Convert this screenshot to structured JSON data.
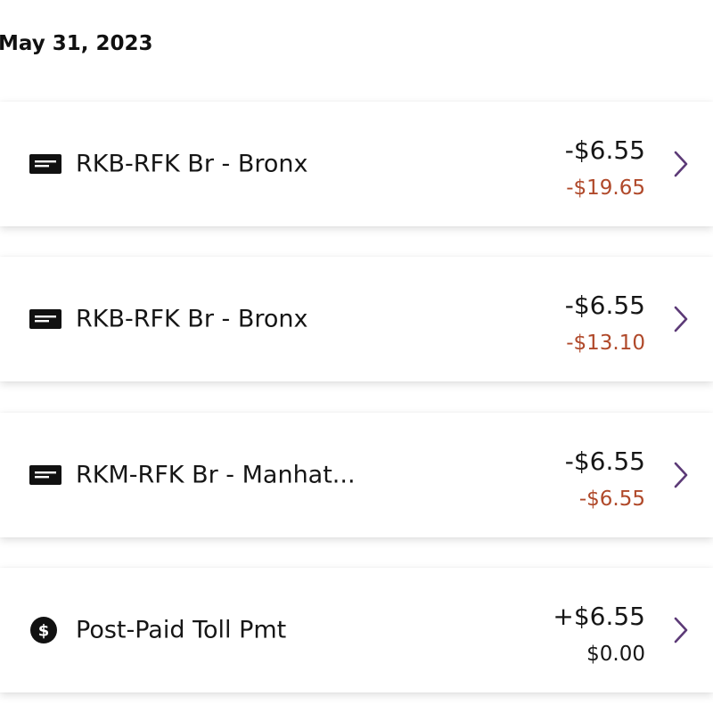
{
  "date_header": "May 31, 2023",
  "colors": {
    "negative_balance": "#b0492a",
    "neutral_balance": "#161616",
    "chevron": "#5c3a77",
    "icon": "#111111"
  },
  "transactions": [
    {
      "icon": "tag-icon",
      "title": "RKB-RFK Br - Bronx",
      "amount": "-$6.55",
      "balance": "-$19.65",
      "balance_status": "negative"
    },
    {
      "icon": "tag-icon",
      "title": "RKB-RFK Br - Bronx",
      "amount": "-$6.55",
      "balance": "-$13.10",
      "balance_status": "negative"
    },
    {
      "icon": "tag-icon",
      "title": "RKM-RFK Br - Manhat...",
      "amount": "-$6.55",
      "balance": "-$6.55",
      "balance_status": "negative"
    },
    {
      "icon": "dollar-icon",
      "title": "Post-Paid Toll Pmt",
      "amount": "+$6.55",
      "balance": "$0.00",
      "balance_status": "neutral"
    }
  ]
}
